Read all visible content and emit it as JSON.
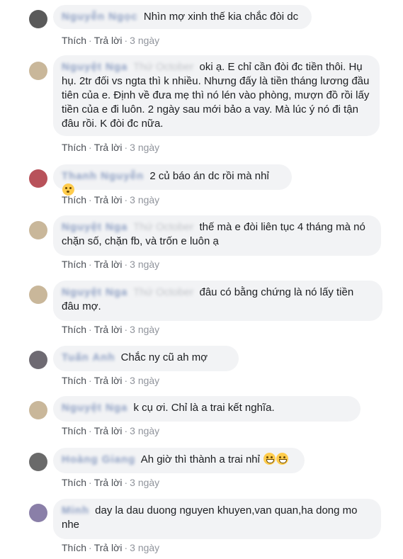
{
  "actions": {
    "like": "Thích",
    "reply": "Trả lời",
    "time": "3 ngày",
    "dot": "·"
  },
  "comments": [
    {
      "name": "Nguyễn Ngọc",
      "name_suffix": "",
      "text": "Nhìn mợ xinh thế kia chắc đòi dc",
      "avatar_color": "#5a5a5a"
    },
    {
      "name": "Nguyệt Nga",
      "name_suffix": "Thứ October",
      "text": "oki ạ. E chỉ cần đòi đc tiền thôi. Hụ hụ. 2tr đối vs ngta thì k nhiều. Nhưng đấy là tiền tháng lương đầu tiên của e. Định về đưa mẹ thì nó lén vào phòng, mượn đồ rồi lấy tiền của e đi luôn. 2 ngày sau mới bảo a vay. Mà lúc ý nó đi tận đâu rồi. K đòi đc nữa.",
      "avatar_color": "#c9b79a"
    },
    {
      "name": "Thanh Nguyễn",
      "name_suffix": "",
      "text": "2 củ báo án dc rồi mà nhỉ",
      "emoji": "flushed",
      "avatar_color": "#b8525a"
    },
    {
      "name": "Nguyệt Nga",
      "name_suffix": "Thứ October",
      "text": "thế mà e đòi liên tục 4 tháng mà nó chặn số, chặn fb, và trốn e luôn ạ",
      "avatar_color": "#c9b79a"
    },
    {
      "name": "Nguyệt Nga",
      "name_suffix": "Thứ October",
      "text": "đâu có bằng chứng là nó lấy tiền đâu mợ.",
      "avatar_color": "#c9b79a"
    },
    {
      "name": "Tuấn Anh",
      "name_suffix": "",
      "text": "Chắc ny cũ ah mợ",
      "avatar_color": "#6e6a72"
    },
    {
      "name": "Nguyệt Nga",
      "name_suffix": "",
      "text": "k cụ ơi. Chỉ là a trai kết nghĩa.",
      "avatar_color": "#c9b79a"
    },
    {
      "name": "Hoàng Giang",
      "name_suffix": "",
      "text": "Ah giờ thì thành a trai nhỉ",
      "emoji": "laugh",
      "avatar_color": "#6a6a6a"
    },
    {
      "name": "Minh",
      "name_suffix": "",
      "text": "day la dau duong nguyen khuyen,van quan,ha dong mo nhe",
      "avatar_color": "#8a7fa8"
    }
  ]
}
